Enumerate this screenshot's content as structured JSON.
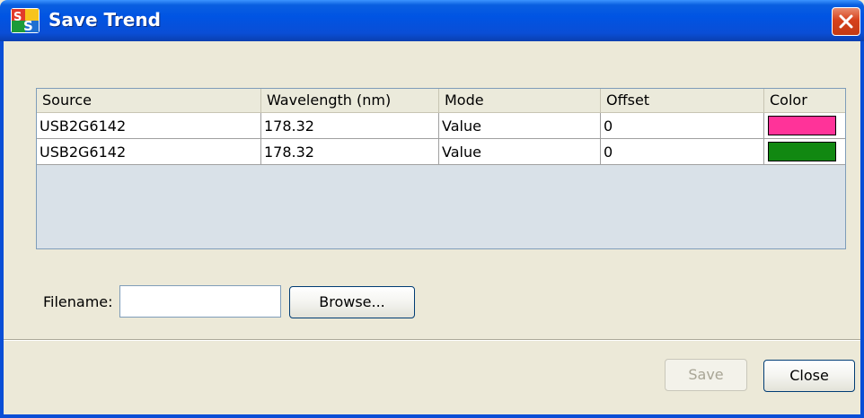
{
  "window": {
    "title": "Save Trend"
  },
  "table": {
    "columns": [
      "Source",
      "Wavelength (nm)",
      "Mode",
      "Offset",
      "Color"
    ],
    "rows": [
      {
        "source": "USB2G6142",
        "wavelength": "178.32",
        "mode": "Value",
        "offset": "0",
        "color": "#ff3399"
      },
      {
        "source": "USB2G6142",
        "wavelength": "178.32",
        "mode": "Value",
        "offset": "0",
        "color": "#118811"
      }
    ]
  },
  "filename": {
    "label": "Filename:",
    "value": ""
  },
  "buttons": {
    "browse": "Browse...",
    "save": "Save",
    "close": "Close"
  },
  "icons": {
    "app": "ss-app-icon",
    "close": "close-x-icon"
  }
}
